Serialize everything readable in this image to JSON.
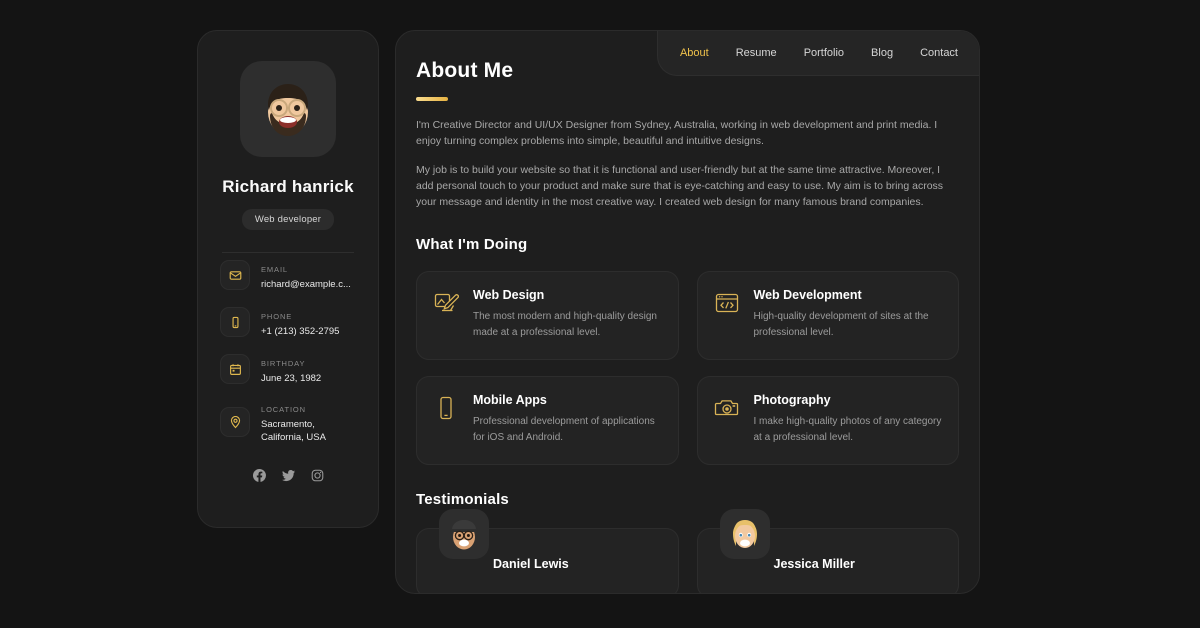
{
  "theme": {
    "page_bg": "#141414",
    "panel_bg": "#1e1e1e",
    "card_bg": "#232323",
    "accent": "#f0c24b",
    "accent_light": "#f9dc8f"
  },
  "sidebar": {
    "avatar_alt": "memoji-avatar",
    "name": "Richard hanrick",
    "badge": "Web developer",
    "contacts": [
      {
        "icon": "mail-icon",
        "label": "EMAIL",
        "value": "richard@example.c...",
        "truncate": true
      },
      {
        "icon": "phone-icon",
        "label": "PHONE",
        "value": "+1 (213) 352-2795",
        "truncate": false
      },
      {
        "icon": "calendar-icon",
        "label": "BIRTHDAY",
        "value": "June 23, 1982",
        "truncate": false
      },
      {
        "icon": "location-icon",
        "label": "LOCATION",
        "value": "Sacramento,\nCalifornia, USA",
        "truncate": false
      }
    ],
    "socials": [
      {
        "icon": "facebook-icon",
        "name": "Facebook"
      },
      {
        "icon": "twitter-icon",
        "name": "Twitter"
      },
      {
        "icon": "instagram-icon",
        "name": "Instagram"
      }
    ]
  },
  "nav": {
    "items": [
      {
        "label": "About",
        "active": true
      },
      {
        "label": "Resume",
        "active": false
      },
      {
        "label": "Portfolio",
        "active": false
      },
      {
        "label": "Blog",
        "active": false
      },
      {
        "label": "Contact",
        "active": false
      }
    ]
  },
  "about": {
    "title": "About Me",
    "paragraphs": [
      "I'm Creative Director and UI/UX Designer from Sydney, Australia, working in web development and print media. I enjoy turning complex problems into simple, beautiful and intuitive designs.",
      "My job is to build your website so that it is functional and user-friendly but at the same time attractive. Moreover, I add personal touch to your product and make sure that is eye-catching and easy to use. My aim is to bring across your message and identity in the most creative way. I created web design for many famous brand companies."
    ]
  },
  "services": {
    "title": "What I'm Doing",
    "items": [
      {
        "icon": "design-pen-icon",
        "title": "Web Design",
        "desc": "The most modern and high-quality design made at a professional level."
      },
      {
        "icon": "code-browser-icon",
        "title": "Web Development",
        "desc": "High-quality development of sites at the professional level."
      },
      {
        "icon": "mobile-phone-icon",
        "title": "Mobile Apps",
        "desc": "Professional development of applications for iOS and Android."
      },
      {
        "icon": "camera-icon",
        "title": "Photography",
        "desc": "I make high-quality photos of any category at a professional level."
      }
    ]
  },
  "testimonials": {
    "title": "Testimonials",
    "items": [
      {
        "avatar": "memoji-avatar-cap",
        "name": "Daniel Lewis"
      },
      {
        "avatar": "memoji-avatar-blond",
        "name": "Jessica Miller"
      }
    ]
  }
}
